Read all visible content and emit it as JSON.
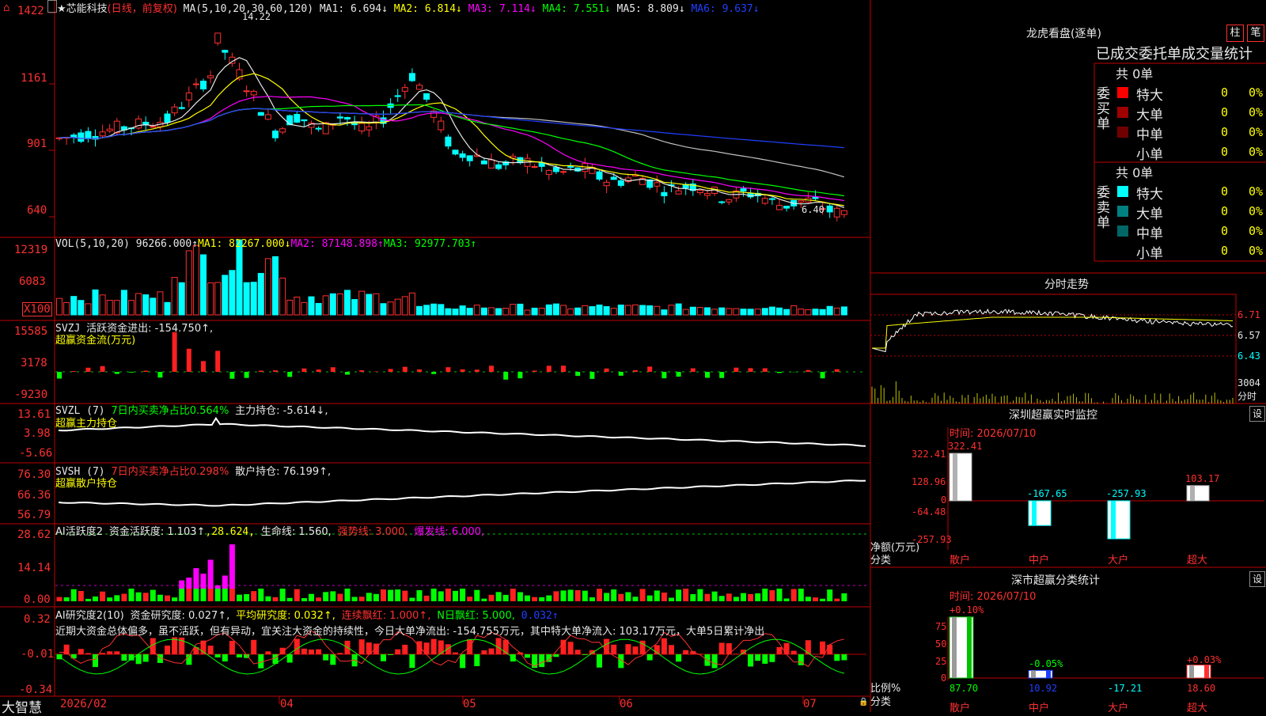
{
  "stock_header": {
    "star": "★",
    "name": "芯能科技",
    "mode": "(日线，前复权)",
    "ma_def": "MA(5,10,20,30,60,120)",
    "ma1": "MA1: 6.694↓",
    "ma2": "MA2: 6.814↓",
    "ma3": "MA3: 7.114↓",
    "ma4": "MA4: 7.551↓",
    "ma5": "MA5: 8.809↓",
    "ma6": "MA6: 9.637↓"
  },
  "price_panel": {
    "high_label": "14.22",
    "low_label": "6.40",
    "y_ticks": [
      "1422",
      "1161",
      "901",
      "640"
    ]
  },
  "vol_panel": {
    "title": "VOL(5,10,20)",
    "val": "96266.000↑",
    "ma1": "MA1: 82267.000↓",
    "ma2": "MA2: 87148.898↑",
    "ma3": "MA3: 92977.703↑",
    "y_ticks": [
      "12319",
      "6083",
      "X100"
    ]
  },
  "svzj_panel": {
    "title": "SVZJ",
    "text": "活跃资金进出: -154.750↑,",
    "subtitle": "超赢资金流(万元)",
    "y_ticks": [
      "15585",
      "3178",
      "-9230"
    ]
  },
  "svzl_panel": {
    "title": "SVZL (7)",
    "ratio": "7日内买卖净占比0.564%",
    "main": "主力持仓: -5.614↓,",
    "subtitle": "超赢主力持仓",
    "y_ticks": [
      "13.61",
      "3.98",
      "-5.66"
    ]
  },
  "svsh_panel": {
    "title": "SVSH (7)",
    "ratio": "7日内买卖净占比0.298%",
    "main": "散户持仓: 76.199↑,",
    "subtitle": "超赢散户持仓",
    "y_ticks": [
      "76.30",
      "66.36",
      "56.79"
    ]
  },
  "ai_active_panel": {
    "title": "AI活跃度2",
    "a": "资金活跃度: 1.103↑",
    "b": ",28.624,",
    "c": "生命线: 1.560,",
    "d": "强势线: 3.000,",
    "e": "爆发线: 6.000,",
    "y_ticks": [
      "28.62",
      "14.14",
      "0.00"
    ]
  },
  "ai_research_panel": {
    "title": "AI研究度2(10)",
    "a": "资金研究度: 0.027↑,",
    "b": "平均研究度: 0.032↑,",
    "c": "连续飘红: 1.000↑,",
    "d": "N日飘红: 5.000,",
    "e": "0.032↑",
    "comment": "近期大资金总体偏多，虽不活跃，但有异动，宜关注大资金的持续性，今日大单净流出: -154.755万元，其中特大单净流入: 103.17万元，大单5日累计净出",
    "y_ticks": [
      "0.32",
      "-0.01",
      "-0.34"
    ]
  },
  "x_axis": {
    "brand": "大智慧",
    "labels": [
      "2026/02",
      "04",
      "05",
      "06",
      "07"
    ]
  },
  "dragon_tiger": {
    "title": "龙虎看盘(逐单)",
    "btn_bar": "柱",
    "btn_pen": "笔",
    "header": "已成交委托单成交量统计",
    "buy_side": "委买单",
    "sell_side": "委卖单",
    "buy_total": "共 0单",
    "sell_total": "共 0单",
    "buy_rows": [
      {
        "label": "特大",
        "count": "0",
        "pct": "0%",
        "color": "#ff0000"
      },
      {
        "label": "大单",
        "count": "0",
        "pct": "0%",
        "color": "#a00000"
      },
      {
        "label": "中单",
        "count": "0",
        "pct": "0%",
        "color": "#700000"
      },
      {
        "label": "小单",
        "count": "0",
        "pct": "0%",
        "color": "#000000"
      }
    ],
    "sell_rows": [
      {
        "label": "特大",
        "count": "0",
        "pct": "0%",
        "color": "#00ffff"
      },
      {
        "label": "大单",
        "count": "0",
        "pct": "0%",
        "color": "#008080"
      },
      {
        "label": "中单",
        "count": "0",
        "pct": "0%",
        "color": "#006666"
      },
      {
        "label": "小单",
        "count": "0",
        "pct": "0%",
        "color": "#000000"
      }
    ]
  },
  "intraday": {
    "title": "分时走势",
    "p_hi": "6.71",
    "p_mid": "6.57",
    "p_lo": "6.43",
    "vol": "3004",
    "unit": "分时"
  },
  "sz_monitor": {
    "title": "深圳超赢实时监控",
    "set": "设",
    "time": "时间: 2026/07/10",
    "y_ticks": [
      "322.41",
      "128.96",
      "0",
      "-64.48",
      "-257.93"
    ],
    "ylabel": "净额(万元)",
    "xlabel": "分类",
    "categories": [
      "散户",
      "中户",
      "大户",
      "超大"
    ],
    "values": [
      "322.41",
      "-167.65",
      "-257.93",
      "103.17"
    ]
  },
  "sz_class": {
    "title": "深市超赢分类统计",
    "set": "设",
    "time": "时间: 2026/07/10",
    "y_ticks": [
      "75",
      "50",
      "25",
      "0"
    ],
    "ylabel": "比例%",
    "xlabel": "分类",
    "categories": [
      "散户",
      "中户",
      "大户",
      "超大"
    ],
    "top_labels": [
      "+0.10%",
      "-0.05%",
      "",
      "+0.03%"
    ],
    "bottom_values": [
      "87.70",
      "10.92",
      "-17.21",
      "18.60"
    ]
  },
  "chart_data": [
    {
      "type": "bar",
      "title": "深圳超赢实时监控",
      "ylabel": "净额(万元)",
      "categories": [
        "散户",
        "中户",
        "大户",
        "超大"
      ],
      "values": [
        322.41,
        -167.65,
        -257.93,
        103.17
      ],
      "ylim": [
        -257.93,
        322.41
      ]
    },
    {
      "type": "bar",
      "title": "深市超赢分类统计",
      "ylabel": "比例%",
      "categories": [
        "散户",
        "中户",
        "大户",
        "超大"
      ],
      "values": [
        87.7,
        10.92,
        -17.21,
        18.6
      ],
      "ylim": [
        0,
        75
      ]
    }
  ]
}
